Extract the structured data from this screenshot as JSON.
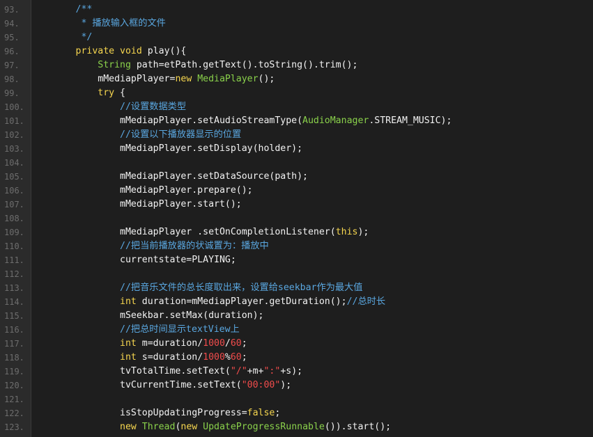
{
  "editor": {
    "lines": [
      {
        "number": "93.",
        "tokens": [
          {
            "t": "comment",
            "v": "        /**"
          }
        ]
      },
      {
        "number": "94.",
        "tokens": [
          {
            "t": "comment",
            "v": "         * 播放输入框的文件"
          }
        ]
      },
      {
        "number": "95.",
        "tokens": [
          {
            "t": "comment",
            "v": "         */"
          }
        ]
      },
      {
        "number": "96.",
        "tokens": [
          {
            "t": "keyword",
            "v": "        private "
          },
          {
            "t": "keyword",
            "v": "void "
          },
          {
            "t": "plain",
            "v": "play(){"
          }
        ]
      },
      {
        "number": "97.",
        "tokens": [
          {
            "t": "type",
            "v": "            String "
          },
          {
            "t": "plain",
            "v": "path=etPath.getText().toString().trim();"
          }
        ]
      },
      {
        "number": "98.",
        "tokens": [
          {
            "t": "plain",
            "v": "            mMediapPlayer="
          },
          {
            "t": "keyword",
            "v": "new "
          },
          {
            "t": "type",
            "v": "MediaPlayer"
          },
          {
            "t": "plain",
            "v": "();"
          }
        ]
      },
      {
        "number": "99.",
        "tokens": [
          {
            "t": "keyword",
            "v": "            try "
          },
          {
            "t": "plain",
            "v": "{"
          }
        ]
      },
      {
        "number": "100.",
        "tokens": [
          {
            "t": "comment",
            "v": "                //设置数据类型"
          }
        ]
      },
      {
        "number": "101.",
        "tokens": [
          {
            "t": "plain",
            "v": "                mMediapPlayer.setAudioStreamType("
          },
          {
            "t": "type",
            "v": "AudioManager"
          },
          {
            "t": "plain",
            "v": ".STREAM_MUSIC);"
          }
        ]
      },
      {
        "number": "102.",
        "tokens": [
          {
            "t": "comment",
            "v": "                //设置以下播放器显示的位置"
          }
        ]
      },
      {
        "number": "103.",
        "tokens": [
          {
            "t": "plain",
            "v": "                mMediapPlayer.setDisplay(holder);"
          }
        ]
      },
      {
        "number": "104.",
        "tokens": [
          {
            "t": "plain",
            "v": ""
          }
        ]
      },
      {
        "number": "105.",
        "tokens": [
          {
            "t": "plain",
            "v": "                mMediapPlayer.setDataSource(path);"
          }
        ]
      },
      {
        "number": "106.",
        "tokens": [
          {
            "t": "plain",
            "v": "                mMediapPlayer.prepare();"
          }
        ]
      },
      {
        "number": "107.",
        "tokens": [
          {
            "t": "plain",
            "v": "                mMediapPlayer.start();"
          }
        ]
      },
      {
        "number": "108.",
        "tokens": [
          {
            "t": "plain",
            "v": ""
          }
        ]
      },
      {
        "number": "109.",
        "tokens": [
          {
            "t": "plain",
            "v": "                mMediapPlayer .setOnCompletionListener("
          },
          {
            "t": "keyword",
            "v": "this"
          },
          {
            "t": "plain",
            "v": ");"
          }
        ]
      },
      {
        "number": "110.",
        "tokens": [
          {
            "t": "comment",
            "v": "                //把当前播放器的状诚置为：播放中"
          }
        ]
      },
      {
        "number": "111.",
        "tokens": [
          {
            "t": "plain",
            "v": "                currentstate=PLAYING;"
          }
        ]
      },
      {
        "number": "112.",
        "tokens": [
          {
            "t": "plain",
            "v": ""
          }
        ]
      },
      {
        "number": "113.",
        "tokens": [
          {
            "t": "comment",
            "v": "                //把音乐文件的总长度取出来，设置给seekbar作为最大值"
          }
        ]
      },
      {
        "number": "114.",
        "tokens": [
          {
            "t": "keyword",
            "v": "                int "
          },
          {
            "t": "plain",
            "v": "duration=mMediapPlayer.getDuration();"
          },
          {
            "t": "comment",
            "v": "//总时长"
          }
        ]
      },
      {
        "number": "115.",
        "tokens": [
          {
            "t": "plain",
            "v": "                mSeekbar.setMax(duration);"
          }
        ]
      },
      {
        "number": "116.",
        "tokens": [
          {
            "t": "comment",
            "v": "                //把总时间显示textView上"
          }
        ]
      },
      {
        "number": "117.",
        "tokens": [
          {
            "t": "keyword",
            "v": "                int "
          },
          {
            "t": "plain",
            "v": "m=duration/"
          },
          {
            "t": "number",
            "v": "1000"
          },
          {
            "t": "plain",
            "v": "/"
          },
          {
            "t": "number",
            "v": "60"
          },
          {
            "t": "plain",
            "v": ";"
          }
        ]
      },
      {
        "number": "118.",
        "tokens": [
          {
            "t": "keyword",
            "v": "                int "
          },
          {
            "t": "plain",
            "v": "s=duration/"
          },
          {
            "t": "number",
            "v": "1000"
          },
          {
            "t": "plain",
            "v": "%"
          },
          {
            "t": "number",
            "v": "60"
          },
          {
            "t": "plain",
            "v": ";"
          }
        ]
      },
      {
        "number": "119.",
        "tokens": [
          {
            "t": "plain",
            "v": "                tvTotalTime.setText("
          },
          {
            "t": "string",
            "v": "\"/\""
          },
          {
            "t": "plain",
            "v": "+m+"
          },
          {
            "t": "string",
            "v": "\":\""
          },
          {
            "t": "plain",
            "v": "+s);"
          }
        ]
      },
      {
        "number": "120.",
        "tokens": [
          {
            "t": "plain",
            "v": "                tvCurrentTime.setText("
          },
          {
            "t": "string",
            "v": "\"00:00\""
          },
          {
            "t": "plain",
            "v": ");"
          }
        ]
      },
      {
        "number": "121.",
        "tokens": [
          {
            "t": "plain",
            "v": ""
          }
        ]
      },
      {
        "number": "122.",
        "tokens": [
          {
            "t": "plain",
            "v": "                isStopUpdatingProgress="
          },
          {
            "t": "keyword",
            "v": "false"
          },
          {
            "t": "plain",
            "v": ";"
          }
        ]
      },
      {
        "number": "123.",
        "tokens": [
          {
            "t": "keyword",
            "v": "                new "
          },
          {
            "t": "type",
            "v": "Thread"
          },
          {
            "t": "plain",
            "v": "("
          },
          {
            "t": "keyword",
            "v": "new "
          },
          {
            "t": "type",
            "v": "UpdateProgressRunnable"
          },
          {
            "t": "plain",
            "v": "()).start();"
          }
        ]
      }
    ]
  },
  "colors": {
    "background": "#1e1e1e",
    "gutter": "#2b2b2b",
    "comment": "#5aa7e0",
    "keyword": "#f6d64f",
    "type": "#8ad14b",
    "plain": "#f2f2f2",
    "number": "#f14c4c",
    "string": "#f14c4c"
  }
}
